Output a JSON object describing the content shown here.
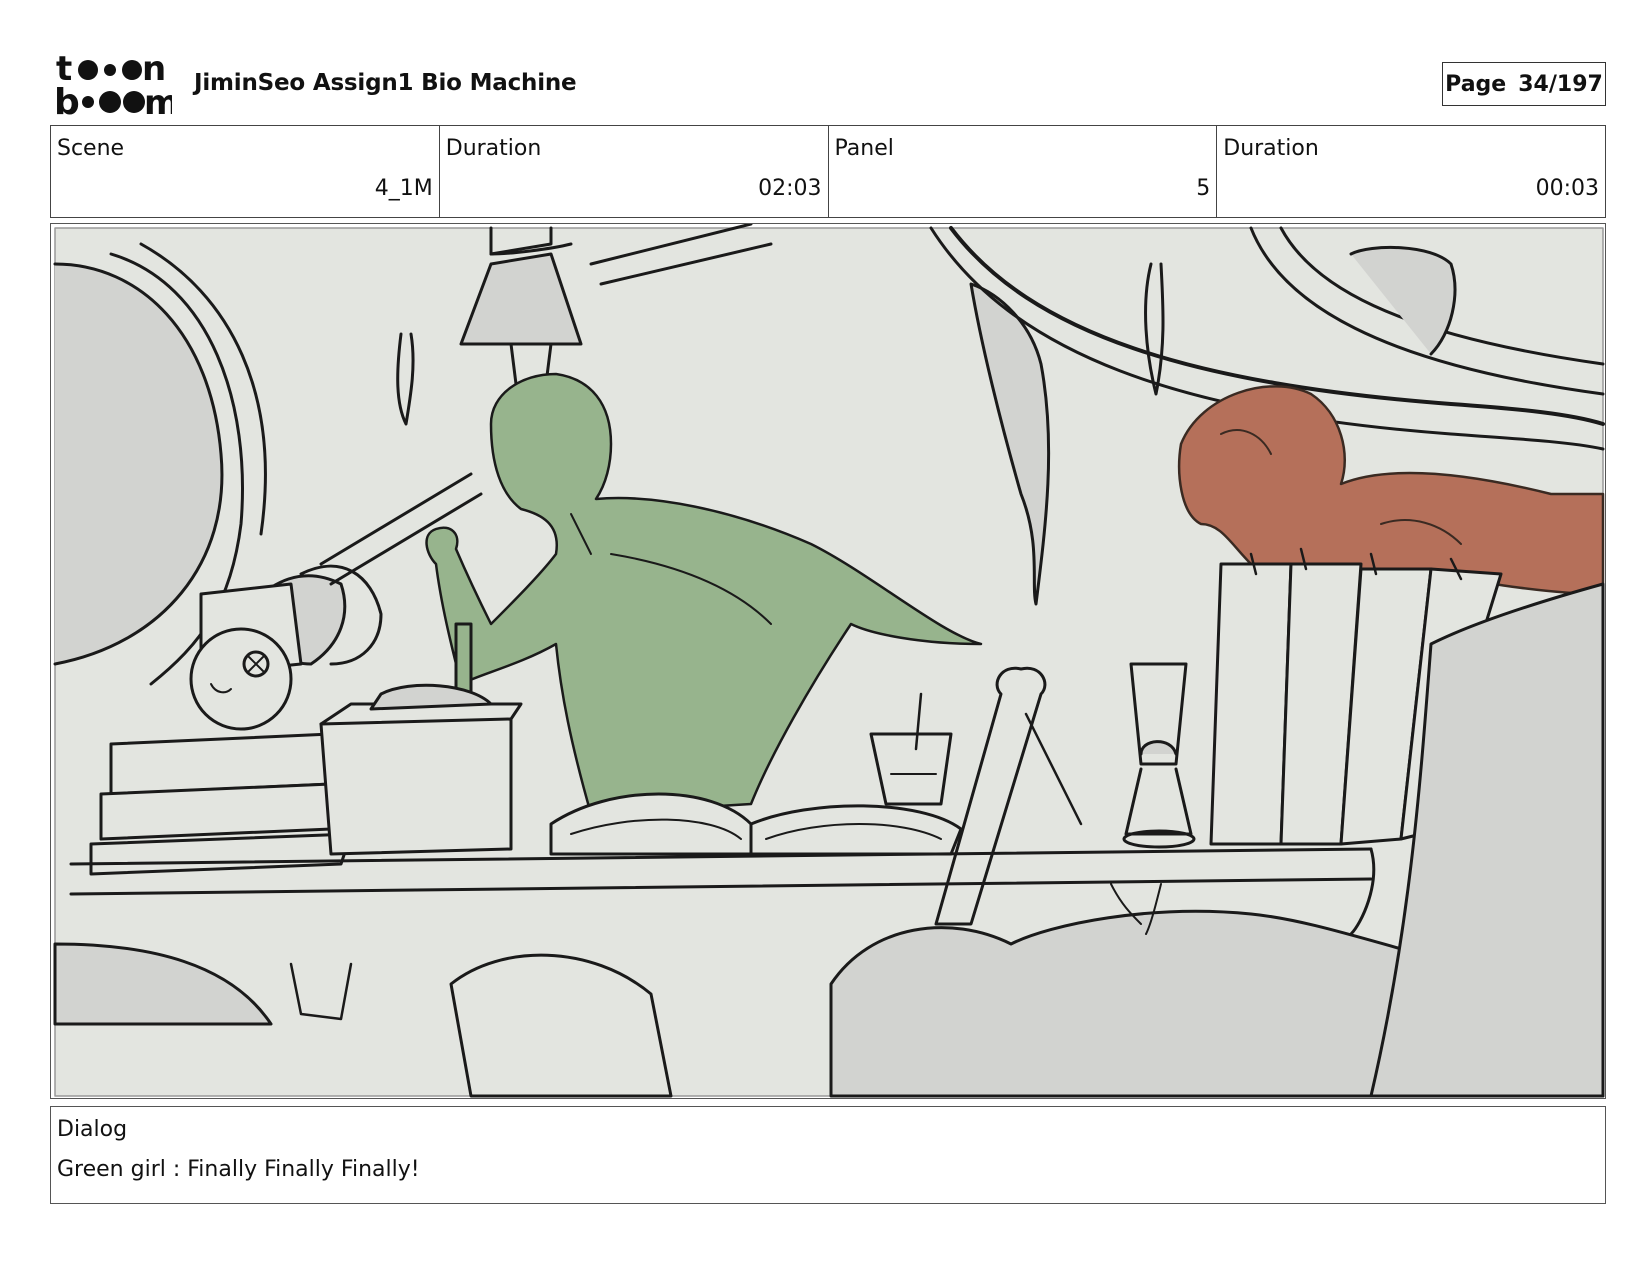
{
  "header": {
    "logo_text": "toon boom",
    "project_title": "JiminSeo Assign1 Bio Machine",
    "page_label": "Page",
    "page_number": "34/197"
  },
  "info": {
    "scene_label": "Scene",
    "scene_value": "4_1M",
    "scene_duration_label": "Duration",
    "scene_duration_value": "02:03",
    "panel_label": "Panel",
    "panel_value": "5",
    "panel_duration_label": "Duration",
    "panel_duration_value": "00:03"
  },
  "panel": {
    "colors": {
      "background": "#e3e5e0",
      "green_girl": "#97b48d",
      "red_figure": "#b5705a",
      "line": "#1a1a1a",
      "grey_fill": "#d2d3d0"
    }
  },
  "dialog": {
    "label": "Dialog",
    "text": "Green girl : Finally Finally Finally!"
  }
}
